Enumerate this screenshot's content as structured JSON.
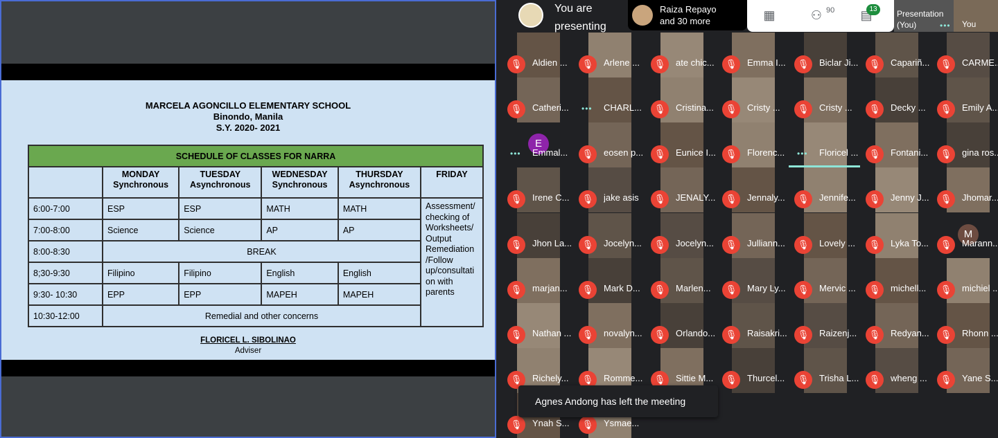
{
  "slide": {
    "school": "MARCELA AGONCILLO ELEMENTARY SCHOOL",
    "location": "Binondo, Manila",
    "school_year": "S.Y. 2020- 2021",
    "table_title": "SCHEDULE OF CLASSES FOR NARRA",
    "days": [
      {
        "day": "MONDAY",
        "mode": "Synchronous"
      },
      {
        "day": "TUESDAY",
        "mode": "Asynchronous"
      },
      {
        "day": "WEDNESDAY",
        "mode": "Synchronous"
      },
      {
        "day": "THURSDAY",
        "mode": "Asynchronous"
      }
    ],
    "friday_header": "FRIDAY",
    "friday_text": "Assessment/ checking of Worksheets/ Output Remediation /Follow up/consultati on with parents",
    "rows": [
      {
        "time": "6:00-7:00",
        "subjects": [
          "ESP",
          "ESP",
          "MATH",
          "MATH"
        ]
      },
      {
        "time": "7:00-8:00",
        "subjects": [
          "Science",
          "Science",
          "AP",
          "AP"
        ]
      },
      {
        "time": "8:00-8:30",
        "span": "BREAK"
      },
      {
        "time": "8;30-9:30",
        "subjects": [
          "Filipino",
          "Filipino",
          "English",
          "English"
        ]
      },
      {
        "time": "9:30-  10:30",
        "subjects": [
          "EPP",
          "EPP",
          "MAPEH",
          "MAPEH"
        ]
      },
      {
        "time": "10:30-12:00",
        "span": "Remedial  and other concerns"
      }
    ],
    "adviser_name": "FLORICEL L. SIBOLINAO",
    "adviser_title": "Adviser"
  },
  "topbar": {
    "presenting_line1": "You are",
    "presenting_line2": "presenting",
    "raiza_line1": "Raiza Repayo",
    "raiza_line2": "and 30 more",
    "people_count": "90",
    "chat_count": "13",
    "presentation_line1": "Presentation",
    "presentation_line2": "(You)",
    "you_label": "You",
    "icons": [
      "grid-layout-icon",
      "people-icon",
      "chat-icon"
    ]
  },
  "participants": [
    "Aldien ...",
    "Arlene ...",
    "ate chic...",
    "Emma I...",
    "Biclar Ji...",
    "Capariñ...",
    "CARME...",
    "Catheri...",
    "CHARL...",
    "Cristina...",
    "Cristy ...",
    "Cristy ...",
    "Decky ...",
    "Emily A...",
    "Emmal...",
    "eosen p...",
    "Eunice I...",
    "Florenc...",
    "Floricel ...",
    "Fontani...",
    "gina ros...",
    "Irene C...",
    "jake asis",
    "JENALY...",
    "Jennaly...",
    "Jennife...",
    "Jenny J...",
    "Jhomar...",
    "Jhon La...",
    "Jocelyn...",
    "Jocelyn...",
    "Julliann...",
    "Lovely ...",
    "Lyka To...",
    "Marann...",
    "marjan...",
    "Mark D...",
    "Marlen...",
    "Mary Ly...",
    "Mervic ...",
    "michell...",
    "michiel ...",
    "Nathan ...",
    "novalyn...",
    "Orlando...",
    "Raisakri...",
    "Raizenj...",
    "Redyan...",
    "Rhonn ...",
    "Richely...",
    "Romme...",
    "Sittie M...",
    "Thurcel...",
    "Trisha L...",
    "wheng ...",
    "Yane S...",
    "Ynah S...",
    "Ysmae..."
  ],
  "letter_avatars": {
    "Emmal...": "E",
    "Marann...": "M"
  },
  "toast": "Agnes Andong has left the meeting"
}
